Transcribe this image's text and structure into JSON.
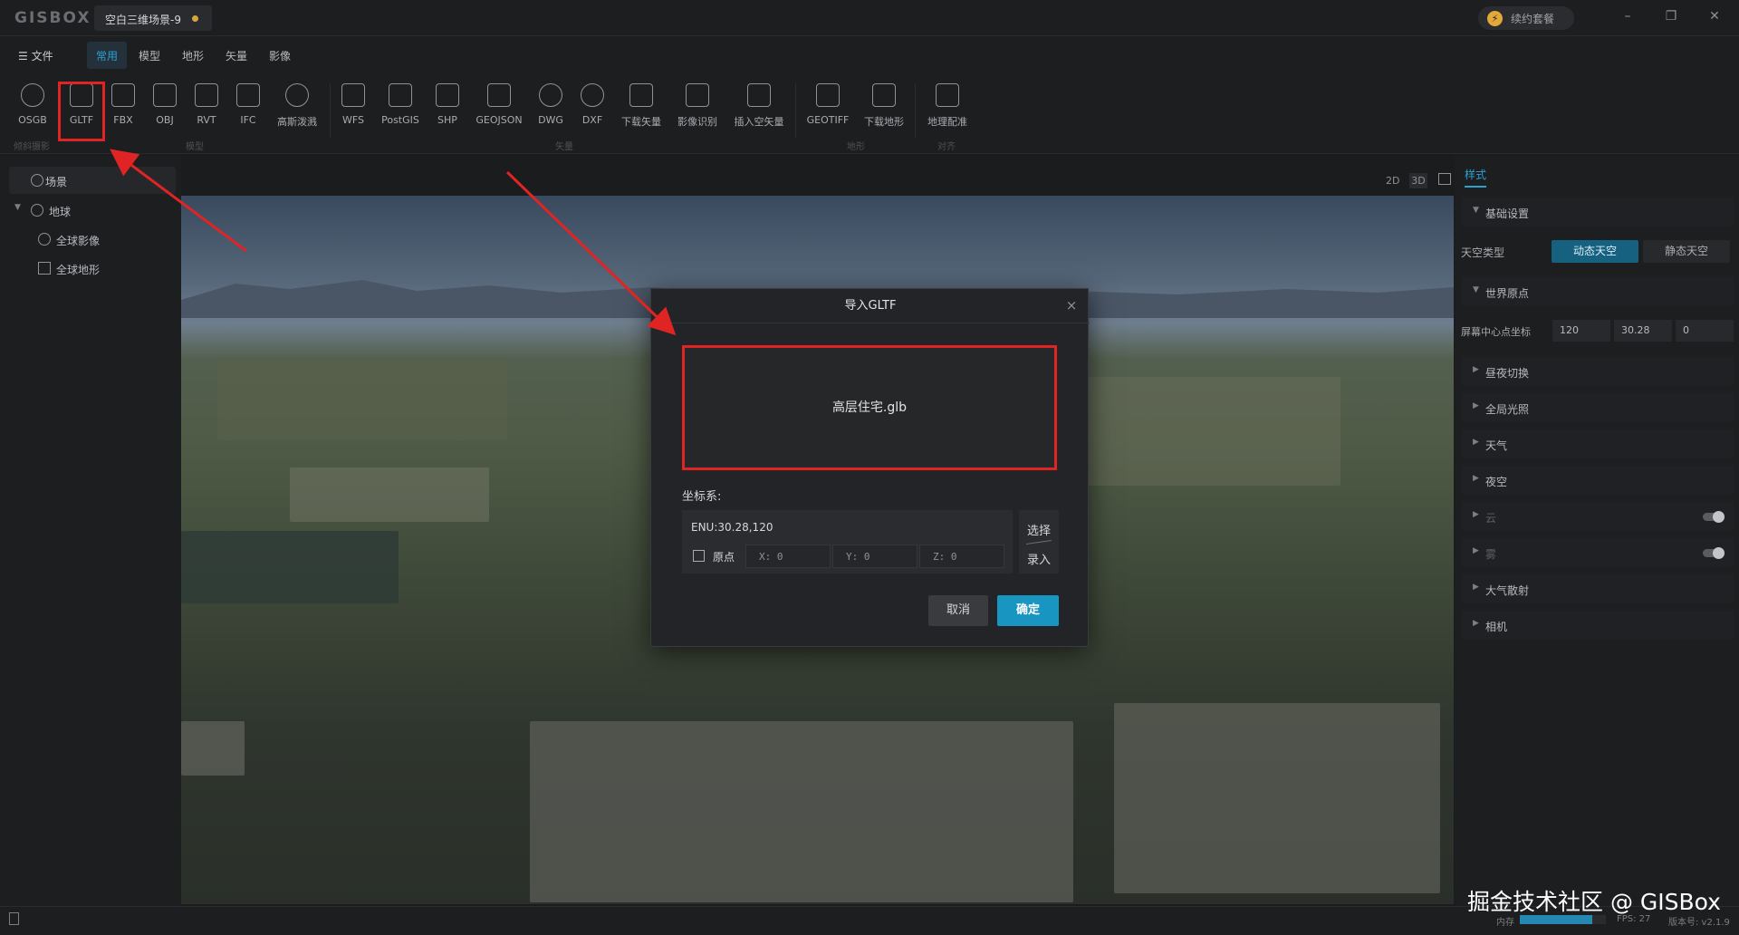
{
  "titlebar": {
    "logo": "GISBOX",
    "doc_tab": "空白三维场景-9",
    "renew": "续约套餐",
    "renew_icon": "lightning-icon",
    "win_min": "–",
    "win_restore": "❐",
    "win_close": "✕"
  },
  "menu": {
    "file": "☰  文件",
    "tabs": [
      "常用",
      "模型",
      "地形",
      "矢量",
      "影像"
    ]
  },
  "ribbon": {
    "tools": [
      "OSGB",
      "GLTF",
      "FBX",
      "OBJ",
      "RVT",
      "IFC",
      "高斯泼溅",
      "WFS",
      "PostGIS",
      "SHP",
      "GEOJSON",
      "DWG",
      "DXF",
      "下载矢量",
      "影像识别",
      "插入空矢量",
      "GEOTIFF",
      "下载地形",
      "地理配准"
    ],
    "groups": [
      "倾斜摄影",
      "模型",
      "矢量",
      "地形",
      "对齐"
    ]
  },
  "left": {
    "scene": "场景",
    "earth": "地球",
    "global_imagery": "全球影像",
    "global_terrain": "全球地形"
  },
  "view": {
    "mode_2d": "2D",
    "mode_3d": "3D"
  },
  "right": {
    "tab": "样式",
    "basic": "基础设置",
    "sky_type": "天空类型",
    "dynamic_sky": "动态天空",
    "static_sky": "静态天空",
    "world_origin": "世界原点",
    "screen_center": "屏幕中心点坐标",
    "coords": [
      "120",
      "30.28",
      "0"
    ],
    "sections": [
      "昼夜切换",
      "全局光照",
      "天气",
      "夜空",
      "云",
      "雾",
      "大气散射",
      "相机"
    ]
  },
  "dialog": {
    "title": "导入GLTF",
    "close": "×",
    "file_name": "高层住宅.glb",
    "crs_label": "坐标系:",
    "crs_value": "ENU:30.28,120",
    "origin": "原点",
    "x": "X: 0",
    "y": "Y: 0",
    "z": "Z: 0",
    "select": "选择",
    "enter": "录入",
    "cancel": "取消",
    "ok": "确定"
  },
  "status": {
    "watermark": "掘金技术社区 @ GISBox",
    "memory": "内存",
    "memory_usage": 0.84,
    "fps": "FPS: 27",
    "version": "版本号: v2.1.9"
  },
  "colors": {
    "accent": "#2ba1d4",
    "highlight": "#e02424",
    "primary_button": "#1895c0"
  }
}
